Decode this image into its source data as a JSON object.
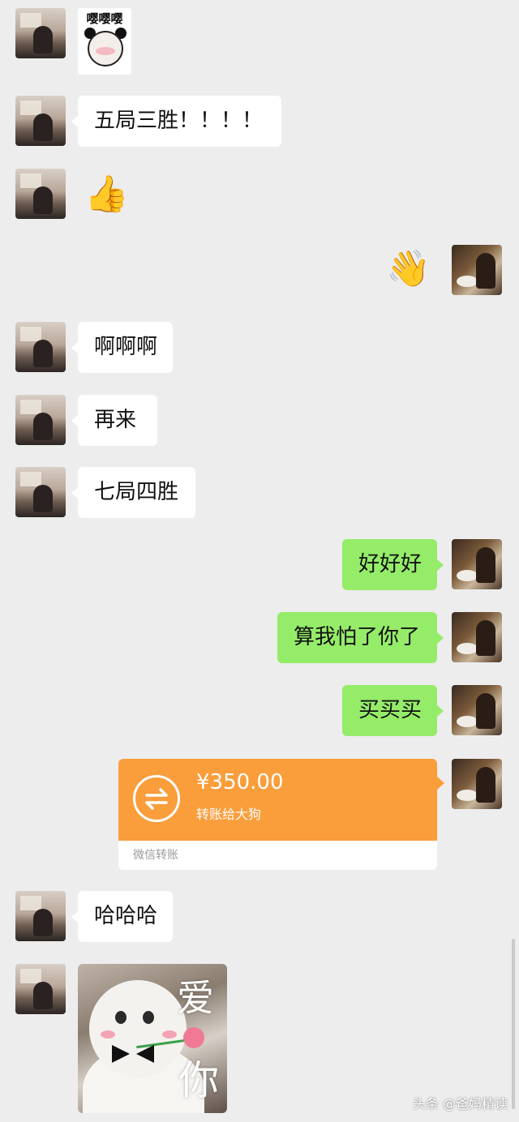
{
  "messages": {
    "m1_sticker_text": "嘤嘤嘤",
    "m2_text": "五局三胜！！！！",
    "m3_emoji": "👍",
    "m4_emoji": "👋",
    "m5_text": "啊啊啊",
    "m6_text": "再来",
    "m7_text": "七局四胜",
    "m8_text": "好好好",
    "m9_text": "算我怕了你了",
    "m10_text": "买买买",
    "m12_text": "哈哈哈",
    "m13_sticker_text_top": "爱",
    "m13_sticker_text_bottom": "你"
  },
  "transfer": {
    "amount": "¥350.00",
    "note": "转账给大狗",
    "footer": "微信转账",
    "icon": "transfer-arrows-icon",
    "color": "#fa9d3b"
  },
  "watermark": "头条 @爸妈精读",
  "colors": {
    "background": "#ededed",
    "bubble_left": "#ffffff",
    "bubble_right": "#95ec69"
  }
}
